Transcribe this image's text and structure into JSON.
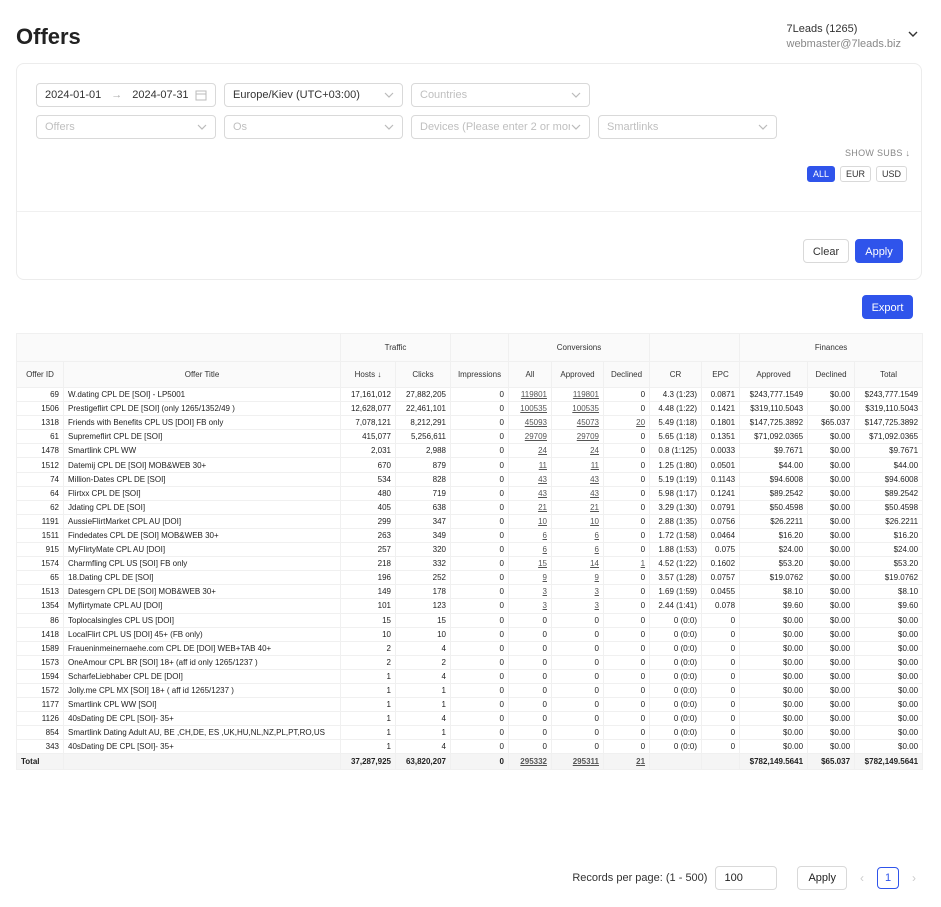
{
  "page": {
    "title": "Offers"
  },
  "account": {
    "name": "7Leads (1265)",
    "email": "webmaster@7leads.biz"
  },
  "filters": {
    "date_from": "2024-01-01",
    "date_arrow": "→",
    "date_to": "2024-07-31",
    "timezone": "Europe/Kiev (UTC+03:00)",
    "countries_placeholder": "Countries",
    "offers_placeholder": "Offers",
    "os_placeholder": "Os",
    "devices_placeholder": "Devices (Please enter 2 or more ch...",
    "smartlinks_placeholder": "Smartlinks",
    "show_subs": "SHOW SUBS",
    "currencies": [
      "ALL",
      "EUR",
      "USD"
    ],
    "currency_selected": "ALL",
    "clear_label": "Clear",
    "apply_label": "Apply"
  },
  "export_label": "Export",
  "table": {
    "group_headers": {
      "traffic": "Traffic",
      "conversions": "Conversions",
      "finances": "Finances"
    },
    "columns": [
      "Offer ID",
      "Offer Title",
      "Hosts",
      "Clicks",
      "Impressions",
      "All",
      "Approved",
      "Declined",
      "CR",
      "EPC",
      "Approved",
      "Declined",
      "Total"
    ],
    "sort_indicator": "↓",
    "rows": [
      [
        "69",
        "W.dating CPL DE [SOI] - LP5001",
        "17,161,012",
        "27,882,205",
        "0",
        "119801",
        "119801",
        "0",
        "4.3 (1:23)",
        "0.0871",
        "$243,777.1549",
        "$0.00",
        "$243,777.1549"
      ],
      [
        "1506",
        "Prestigeflirt CPL DE [SOI] (only 1265/1352/49 )",
        "12,628,077",
        "22,461,101",
        "0",
        "100535",
        "100535",
        "0",
        "4.48 (1:22)",
        "0.1421",
        "$319,110.5043",
        "$0.00",
        "$319,110.5043"
      ],
      [
        "1318",
        "Friends with Benefits CPL US [DOI] FB only",
        "7,078,121",
        "8,212,291",
        "0",
        "45093",
        "45073",
        "20",
        "5.49 (1:18)",
        "0.1801",
        "$147,725.3892",
        "$65.037",
        "$147,725.3892"
      ],
      [
        "61",
        "Supremeflirt CPL DE [SOI]",
        "415,077",
        "5,256,611",
        "0",
        "29709",
        "29709",
        "0",
        "5.65 (1:18)",
        "0.1351",
        "$71,092.0365",
        "$0.00",
        "$71,092.0365"
      ],
      [
        "1478",
        "Smartlink CPL WW",
        "2,031",
        "2,988",
        "0",
        "24",
        "24",
        "0",
        "0.8 (1:125)",
        "0.0033",
        "$9.7671",
        "$0.00",
        "$9.7671"
      ],
      [
        "1512",
        "Datemij CPL DE [SOI] MOB&WEB 30+",
        "670",
        "879",
        "0",
        "11",
        "11",
        "0",
        "1.25 (1:80)",
        "0.0501",
        "$44.00",
        "$0.00",
        "$44.00"
      ],
      [
        "74",
        "Million-Dates CPL DE [SOI]",
        "534",
        "828",
        "0",
        "43",
        "43",
        "0",
        "5.19 (1:19)",
        "0.1143",
        "$94.6008",
        "$0.00",
        "$94.6008"
      ],
      [
        "64",
        "Flirtxx CPL DE [SOI]",
        "480",
        "719",
        "0",
        "43",
        "43",
        "0",
        "5.98 (1:17)",
        "0.1241",
        "$89.2542",
        "$0.00",
        "$89.2542"
      ],
      [
        "62",
        "Jdating CPL DE [SOI]",
        "405",
        "638",
        "0",
        "21",
        "21",
        "0",
        "3.29 (1:30)",
        "0.0791",
        "$50.4598",
        "$0.00",
        "$50.4598"
      ],
      [
        "1191",
        "AussieFlirtMarket CPL AU [DOI]",
        "299",
        "347",
        "0",
        "10",
        "10",
        "0",
        "2.88 (1:35)",
        "0.0756",
        "$26.2211",
        "$0.00",
        "$26.2211"
      ],
      [
        "1511",
        "Findedates CPL DE [SOI] MOB&WEB 30+",
        "263",
        "349",
        "0",
        "6",
        "6",
        "0",
        "1.72 (1:58)",
        "0.0464",
        "$16.20",
        "$0.00",
        "$16.20"
      ],
      [
        "915",
        "MyFlirtyMate CPL AU [DOI]",
        "257",
        "320",
        "0",
        "6",
        "6",
        "0",
        "1.88 (1:53)",
        "0.075",
        "$24.00",
        "$0.00",
        "$24.00"
      ],
      [
        "1574",
        "Charmfling CPL US [SOI] FB only",
        "218",
        "332",
        "0",
        "15",
        "14",
        "1",
        "4.52 (1:22)",
        "0.1602",
        "$53.20",
        "$0.00",
        "$53.20"
      ],
      [
        "65",
        "18.Dating CPL DE [SOI]",
        "196",
        "252",
        "0",
        "9",
        "9",
        "0",
        "3.57 (1:28)",
        "0.0757",
        "$19.0762",
        "$0.00",
        "$19.0762"
      ],
      [
        "1513",
        "Datesgern CPL DE [SOI] MOB&WEB 30+",
        "149",
        "178",
        "0",
        "3",
        "3",
        "0",
        "1.69 (1:59)",
        "0.0455",
        "$8.10",
        "$0.00",
        "$8.10"
      ],
      [
        "1354",
        "Myflirtymate CPL AU [DOI]",
        "101",
        "123",
        "0",
        "3",
        "3",
        "0",
        "2.44 (1:41)",
        "0.078",
        "$9.60",
        "$0.00",
        "$9.60"
      ],
      [
        "86",
        "Toplocalsingles CPL US [DOI]",
        "15",
        "15",
        "0",
        "0",
        "0",
        "0",
        "0 (0:0)",
        "0",
        "$0.00",
        "$0.00",
        "$0.00"
      ],
      [
        "1418",
        "LocalFlirt CPL US [DOI] 45+ (FB only)",
        "10",
        "10",
        "0",
        "0",
        "0",
        "0",
        "0 (0:0)",
        "0",
        "$0.00",
        "$0.00",
        "$0.00"
      ],
      [
        "1589",
        "Fraueninmeinernaehe.com CPL DE [DOI] WEB+TAB 40+",
        "2",
        "4",
        "0",
        "0",
        "0",
        "0",
        "0 (0:0)",
        "0",
        "$0.00",
        "$0.00",
        "$0.00"
      ],
      [
        "1573",
        "OneAmour CPL BR [SOI] 18+ (aff id only 1265/1237 )",
        "2",
        "2",
        "0",
        "0",
        "0",
        "0",
        "0 (0:0)",
        "0",
        "$0.00",
        "$0.00",
        "$0.00"
      ],
      [
        "1594",
        "ScharfeLiebhaber CPL DE [DOI]",
        "1",
        "4",
        "0",
        "0",
        "0",
        "0",
        "0 (0:0)",
        "0",
        "$0.00",
        "$0.00",
        "$0.00"
      ],
      [
        "1572",
        "Jolly.me CPL MX [SOI] 18+ ( aff id 1265/1237 )",
        "1",
        "1",
        "0",
        "0",
        "0",
        "0",
        "0 (0:0)",
        "0",
        "$0.00",
        "$0.00",
        "$0.00"
      ],
      [
        "1177",
        "Smartlink CPL WW [SOI]",
        "1",
        "1",
        "0",
        "0",
        "0",
        "0",
        "0 (0:0)",
        "0",
        "$0.00",
        "$0.00",
        "$0.00"
      ],
      [
        "1126",
        "40sDating DE CPL [SOI]- 35+",
        "1",
        "4",
        "0",
        "0",
        "0",
        "0",
        "0 (0:0)",
        "0",
        "$0.00",
        "$0.00",
        "$0.00"
      ],
      [
        "854",
        "Smartlink Dating Adult AU, BE ,CH,DE, ES ,UK,HU,NL,NZ,PL,PT,RO,US",
        "1",
        "1",
        "0",
        "0",
        "0",
        "0",
        "0 (0:0)",
        "0",
        "$0.00",
        "$0.00",
        "$0.00"
      ],
      [
        "343",
        "40sDating DE CPL [SOI]- 35+",
        "1",
        "4",
        "0",
        "0",
        "0",
        "0",
        "0 (0:0)",
        "0",
        "$0.00",
        "$0.00",
        "$0.00"
      ]
    ],
    "total": [
      "Total",
      "",
      "37,287,925",
      "63,820,207",
      "0",
      "295332",
      "295311",
      "21",
      "",
      "",
      "$782,149.5641",
      "$65.037",
      "$782,149.5641"
    ]
  },
  "pagination": {
    "records_label": "Records per page: (1 - 500)",
    "records_value": "100",
    "apply_label": "Apply",
    "current_page": "1",
    "prev_icon": "‹",
    "next_icon": "›"
  },
  "colors": {
    "primary": "#2f54eb",
    "border": "#d9d9d9",
    "header_bg": "#fafafa"
  }
}
